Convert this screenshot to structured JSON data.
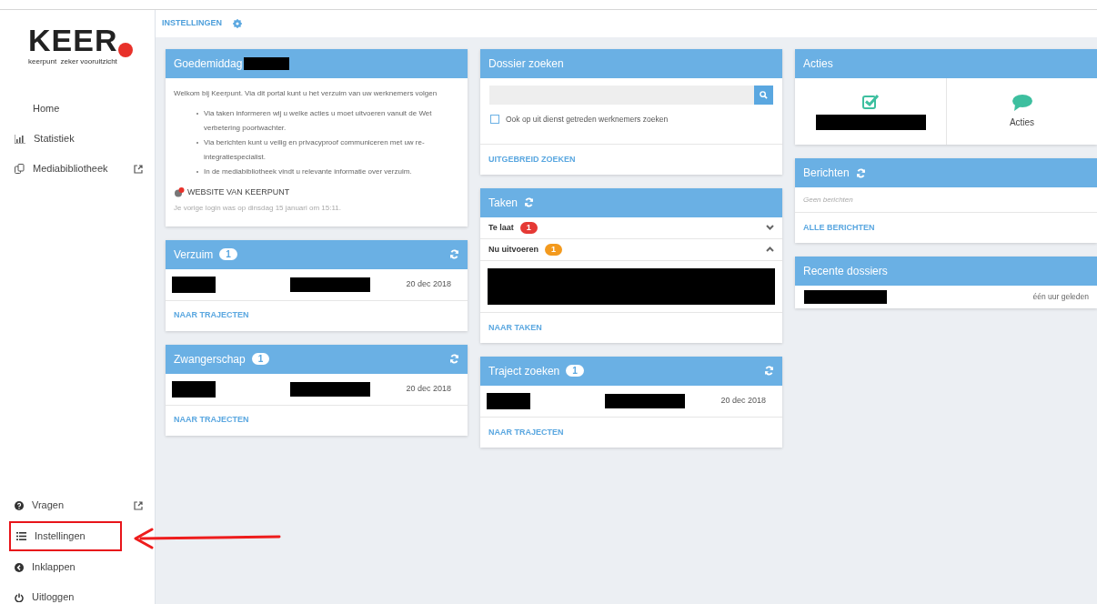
{
  "logo": {
    "wordmark": "KEER",
    "tagline": "keerpunt  zeker vooruitzicht"
  },
  "sidebar": {
    "items": [
      {
        "label": "Home",
        "external": false
      },
      {
        "label": "Statistiek",
        "external": false
      },
      {
        "label": "Mediabibliotheek",
        "external": true
      }
    ],
    "bottom_items": [
      {
        "label": "Vragen",
        "external": true,
        "highlighted": false
      },
      {
        "label": "Instellingen",
        "external": false,
        "highlighted": true
      },
      {
        "label": "Inklappen",
        "external": false,
        "highlighted": false
      },
      {
        "label": "Uitloggen",
        "external": false,
        "highlighted": false
      }
    ]
  },
  "breadcrumb": {
    "label": "INSTELLINGEN"
  },
  "columns": [
    [
      {
        "kind": "welcome",
        "title": "Goedemiddag",
        "intro": "Welkom bij Keerpunt. Via dit portal kunt u het verzuim van uw werknemers volgen",
        "bullets": [
          "Via taken informeren wij u welke acties u moet uitvoeren vanuit de Wet verbetering poortwachter.",
          "Via berichten kunt u veilig en privacyproof communiceren met uw re-integratiespecialist.",
          "In de mediabibliotheek vindt u relevante informatie over verzuim."
        ],
        "website_link": "WEBSITE VAN KEERPUNT",
        "last_login": "Je vorige login was op dinsdag 15 januari om 15:11."
      },
      {
        "kind": "cases",
        "title": "Verzuim",
        "count": "1",
        "rows": [
          {
            "date": "20 dec 2018"
          }
        ],
        "link": "NAAR TRAJECTEN"
      },
      {
        "kind": "cases",
        "title": "Zwangerschap",
        "count": "1",
        "rows": [
          {
            "date": "20 dec 2018"
          }
        ],
        "link": "NAAR TRAJECTEN"
      }
    ],
    [
      {
        "kind": "search",
        "title": "Dossier zoeken",
        "checkbox": {
          "label": "Ook op uit dienst getreden werknemers zoeken",
          "checked": false
        },
        "link": "UITGEBREID ZOEKEN"
      },
      {
        "kind": "tasks",
        "title": "Taken",
        "groups": [
          {
            "label": "Te laat",
            "count": "1",
            "color": "#e53935",
            "expanded": false
          },
          {
            "label": "Nu uitvoeren",
            "count": "1",
            "color": "#f39a1e",
            "expanded": true
          }
        ],
        "link": "NAAR TAKEN"
      },
      {
        "kind": "cases",
        "title": "Traject zoeken",
        "count": "1",
        "rows": [
          {
            "date": "20 dec 2018"
          }
        ],
        "link": "NAAR TRAJECTEN"
      }
    ],
    [
      {
        "kind": "actions",
        "title": "Acties",
        "tiles": [
          {
            "kind": "redacted"
          },
          {
            "kind": "labeled",
            "label": "Acties"
          }
        ]
      },
      {
        "kind": "messages",
        "title": "Berichten",
        "empty_text": "Geen berichten",
        "link": "ALLE BERICHTEN"
      },
      {
        "kind": "recent",
        "title": "Recente dossiers",
        "rows": [
          {
            "time": "één uur geleden"
          }
        ]
      }
    ]
  ]
}
